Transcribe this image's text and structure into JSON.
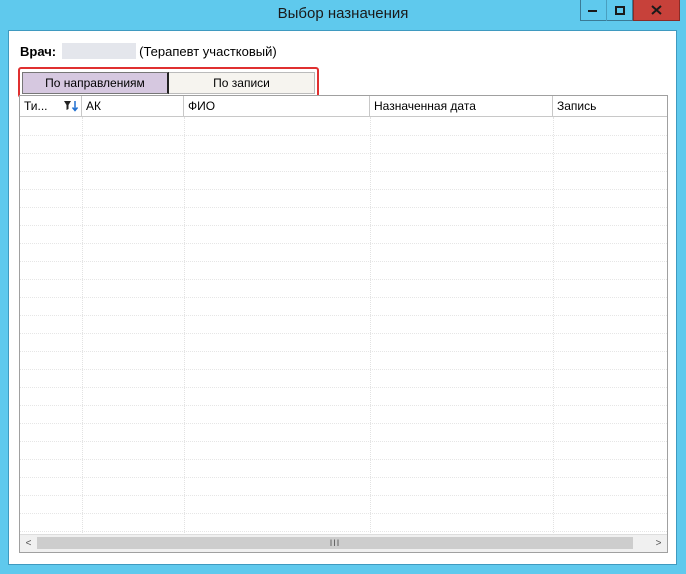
{
  "window": {
    "title": "Выбор назначения",
    "controls": {
      "minimize": "minimize-icon",
      "maximize": "maximize-icon",
      "close": "close-icon"
    }
  },
  "doctor": {
    "label": "Врач:",
    "specialty": "(Терапевт участковый)"
  },
  "tabs": [
    {
      "label": "По направлениям",
      "selected": true
    },
    {
      "label": "По записи",
      "selected": false
    }
  ],
  "grid": {
    "columns": [
      {
        "label": "Ти...",
        "filter_icon": "filter-sort-icon"
      },
      {
        "label": "АК"
      },
      {
        "label": "ФИО"
      },
      {
        "label": "Назначенная дата"
      },
      {
        "label": "Запись"
      }
    ],
    "rows": []
  },
  "scrollbar": {
    "left_arrow": "<",
    "right_arrow": ">",
    "grip": "III"
  },
  "colors": {
    "title_bar": "#5fc9ed",
    "close_button": "#c7413a",
    "tab_selected": "#d6c8e0",
    "highlight_frame": "#e03030"
  }
}
